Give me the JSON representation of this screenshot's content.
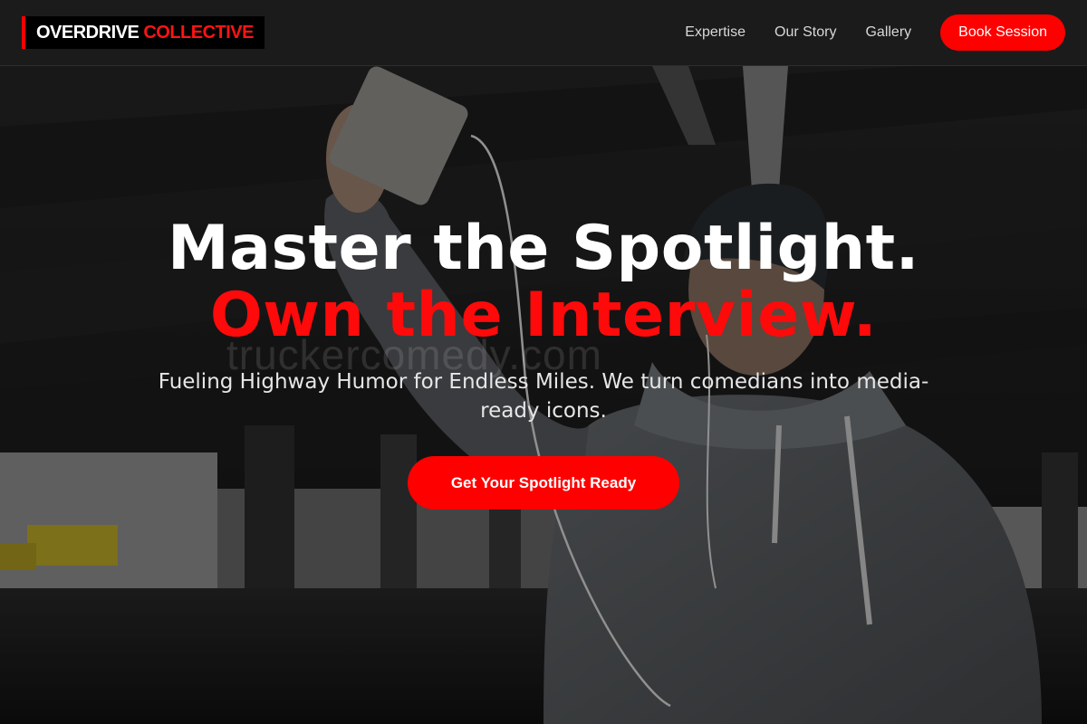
{
  "header": {
    "logo": {
      "word1": "OVERDRIVE",
      "word2": "COLLECTIVE"
    },
    "nav": [
      {
        "label": "Expertise"
      },
      {
        "label": "Our Story"
      },
      {
        "label": "Gallery"
      }
    ],
    "cta_label": "Book Session"
  },
  "hero": {
    "headline_line1": "Master the Spotlight.",
    "headline_line2": "Own the Interview.",
    "subtitle": "Fueling Highway Humor for Endless Miles. We turn comedians into media-ready icons.",
    "cta_label": "Get Your Spotlight Ready",
    "watermark": "truckercomedy.com"
  },
  "colors": {
    "accent": "#ff0000",
    "header_bg": "#1b1b1b",
    "text": "#ffffff"
  }
}
